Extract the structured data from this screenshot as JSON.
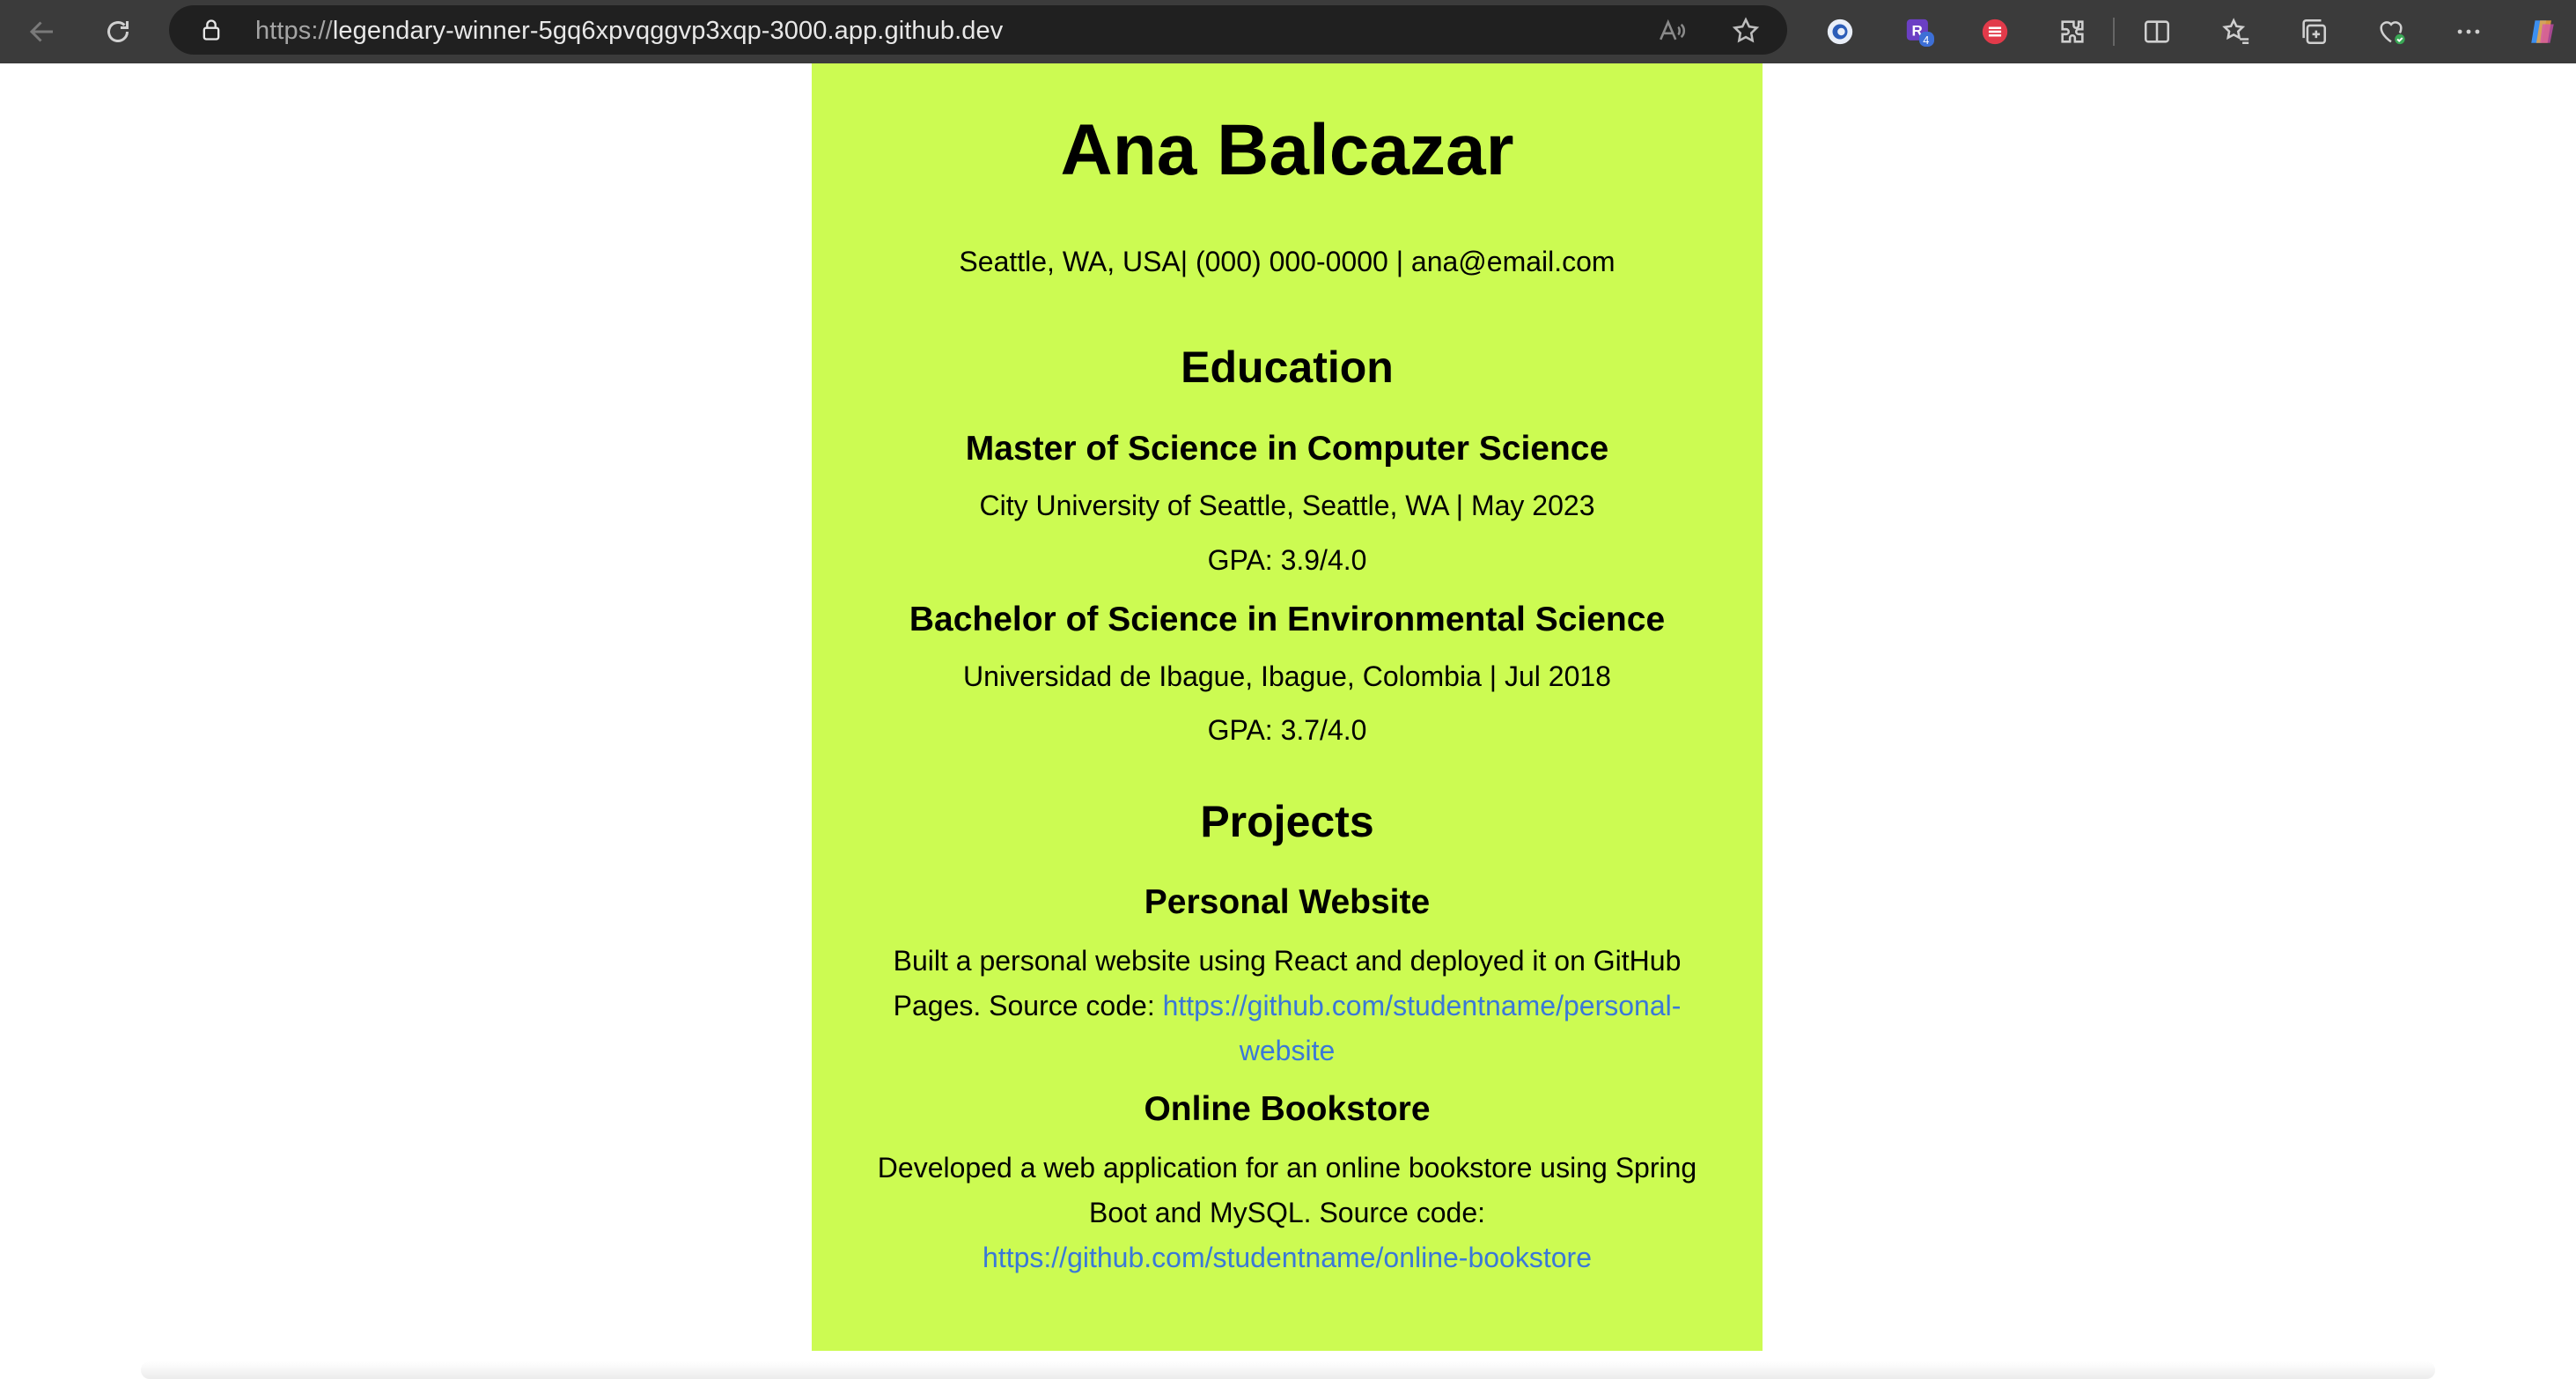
{
  "browser": {
    "url_scheme": "https://",
    "url_host": "legendary-winner-5gq6xpvqggvp3xqp-3000.app.github.dev",
    "extension_badge_count": "4",
    "extension_badge_letter": "R"
  },
  "resume": {
    "name": "Ana Balcazar",
    "contact": "Seattle, WA, USA| (000) 000-0000 | ana@email.com",
    "education": {
      "title": "Education",
      "degrees": [
        {
          "degree": "Master of Science in Computer Science",
          "school": "City University of Seattle, Seattle, WA | May 2023",
          "gpa": "GPA: 3.9/4.0"
        },
        {
          "degree": "Bachelor of Science in Environmental Science",
          "school": "Universidad de Ibague, Ibague, Colombia | Jul 2018",
          "gpa": "GPA: 3.7/4.0"
        }
      ]
    },
    "projects": {
      "title": "Projects",
      "items": [
        {
          "name": "Personal Website",
          "description_line1": "Built a personal website using React and deployed it on GitHub",
          "description_line2": "Pages. Source code: ",
          "link_part1": "https://github.com/studentname/personal-",
          "link_part2": "website"
        },
        {
          "name": "Online Bookstore",
          "description_line1": "Developed a web application for an online bookstore using Spring",
          "description_line2": "Boot and MySQL. Source code:",
          "link": "https://github.com/studentname/online-bookstore"
        }
      ]
    }
  },
  "colors": {
    "resume_background": "#ccfb52",
    "link": "#3a78d8",
    "browser_chrome": "#3b3b3b"
  },
  "icons": [
    "back-arrow-icon",
    "refresh-icon",
    "lock-icon",
    "read-aloud-icon",
    "favorite-star-icon",
    "extensions-icon",
    "split-screen-icon",
    "favorites-icon",
    "collections-icon",
    "browser-essentials-icon",
    "more-icon",
    "copilot-icon"
  ]
}
